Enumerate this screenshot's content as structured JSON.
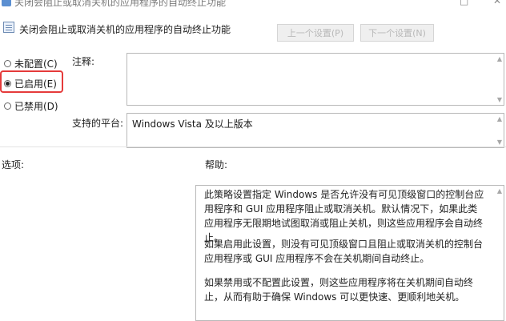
{
  "window": {
    "title": "关闭会阻止或取消关机的应用程序的自动终止功能",
    "controls": [
      "□",
      "✕"
    ]
  },
  "policy": {
    "name": "关闭会阻止或取消关机的应用程序的自动终止功能"
  },
  "nav": {
    "prev": "上一个设置(P)",
    "next": "下一个设置(N)"
  },
  "state": {
    "options": [
      {
        "label": "未配置(C)",
        "hotkey": "C",
        "checked": false
      },
      {
        "label": "已启用(E)",
        "hotkey": "E",
        "checked": true
      },
      {
        "label": "已禁用(D)",
        "hotkey": "D",
        "checked": false
      }
    ]
  },
  "comment": {
    "label": "注释:",
    "value": ""
  },
  "platform": {
    "label": "支持的平台:",
    "value": "Windows Vista 及以上版本"
  },
  "options_section": {
    "label": "选项:"
  },
  "help_section": {
    "label": "帮助:",
    "paragraphs": [
      "此策略设置指定 Windows 是否允许没有可见顶级窗口的控制台应用程序和 GUI 应用程序阻止或取消关机。默认情况下，如果此类应用程序无限期地试图取消或阻止关机，则这些应用程序会自动终止。",
      "如果启用此设置，则没有可见顶级窗口且阻止或取消关机的控制台应用程序或 GUI 应用程序不会在关机期间自动终止。",
      "如果禁用或不配置此设置，则这些应用程序将在关机期间自动终止，从而有助于确保 Windows 可以更快速、更顺利地关机。"
    ]
  },
  "colors": {
    "focus_ring": "#e53b3b",
    "disabled_text": "#b9b9b9"
  }
}
